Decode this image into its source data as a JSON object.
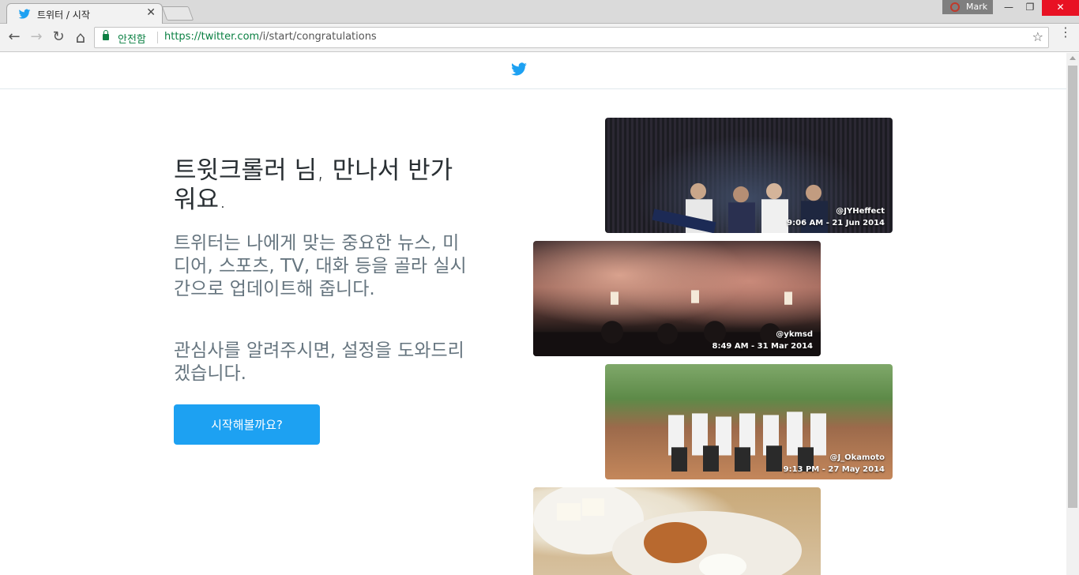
{
  "browser": {
    "tab_title": "트위터 / 시작",
    "tab_close": "✕",
    "profile_name": "Mark",
    "secure_label": "안전함",
    "url_host": "https://twitter.com",
    "url_path": "/i/start/congratulations",
    "controls": {
      "minimize": "—",
      "maximize": "❐",
      "close": "✕"
    },
    "nav": {
      "back": "←",
      "forward": "→",
      "reload": "↻",
      "home": "⌂",
      "star": "☆"
    }
  },
  "page": {
    "headline": "트윗크롤러 님, 만나서 반가워요.",
    "paragraph1": "트위터는 나에게 맞는 중요한 뉴스, 미디어, 스포츠, TV, 대화 등을 골라 실시간으로 업데이트해 줍니다.",
    "paragraph2": "관심사를 알려주시면, 설정을 도와드리겠습니다.",
    "start_button": "시작해볼까요?"
  },
  "photos": [
    {
      "user": "@JYHeffect",
      "time": "9:06 AM - 21 Jun 2014"
    },
    {
      "user": "@ykmsd",
      "time": "8:49 AM - 31 Mar 2014"
    },
    {
      "user": "@J_Okamoto",
      "time": "9:13 PM - 27 May 2014"
    },
    {
      "user": "",
      "time": ""
    }
  ],
  "colors": {
    "twitter_blue": "#1da1f2",
    "secure_green": "#0b8043"
  }
}
